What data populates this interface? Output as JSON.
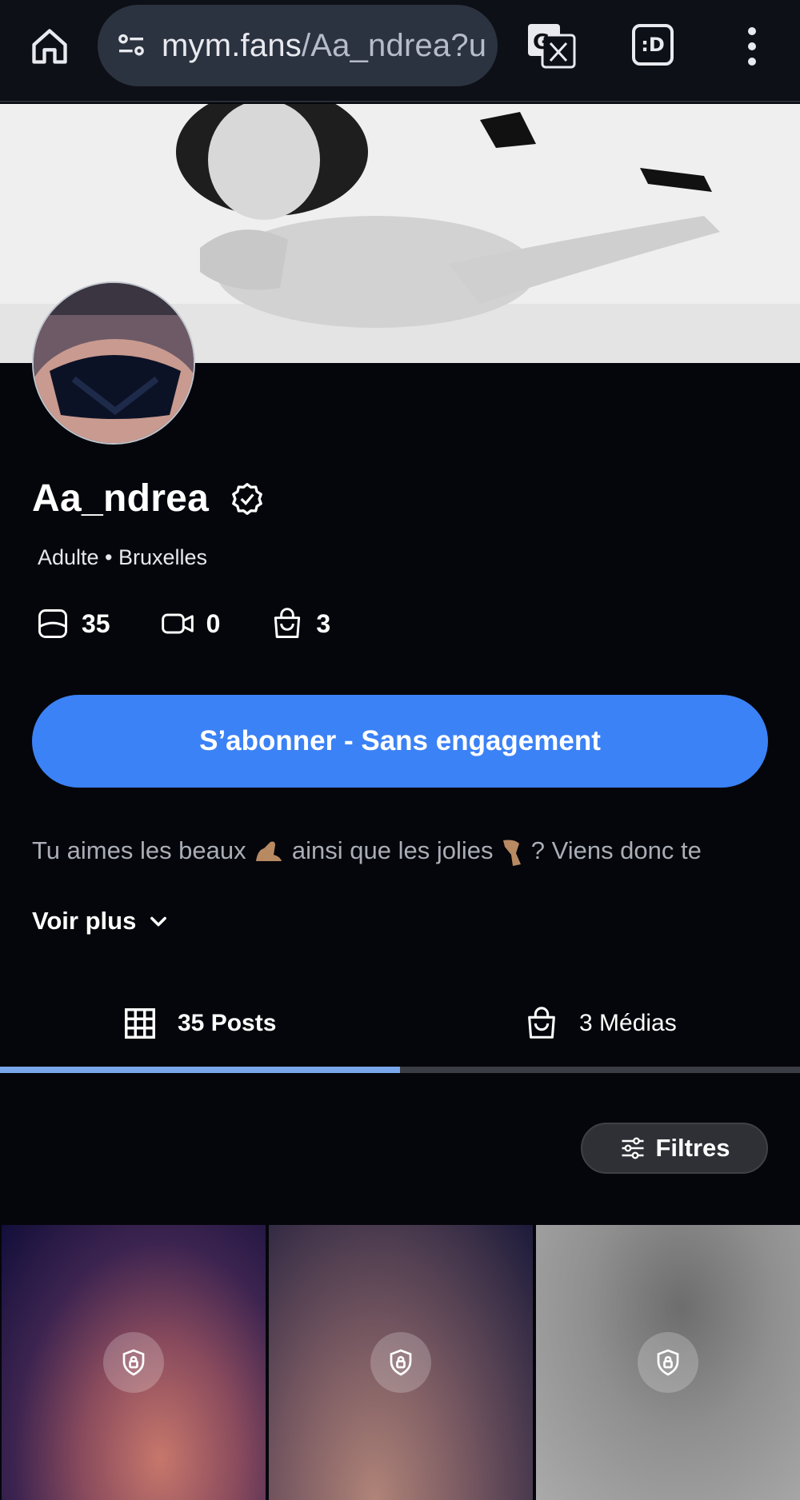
{
  "browser": {
    "url_main": "mym.fans",
    "url_rest": "/Aa_ndrea?u",
    "icons": [
      "home-icon",
      "site-settings-icon",
      "translate-icon",
      "extension-icon",
      "more-vert-icon"
    ]
  },
  "profile": {
    "name": "Aa_ndrea",
    "meta": "Adulte • Bruxelles",
    "stats": {
      "posts": "35",
      "videos": "0",
      "medias": "3"
    }
  },
  "actions": {
    "subscribe_label": "S’abonner - Sans engagement",
    "see_more_label": "Voir plus",
    "filters_label": "Filtres"
  },
  "bio": {
    "part1": "Tu aimes les beaux ",
    "part2": " ainsi que les jolies",
    "part3": " ? Viens donc te"
  },
  "tabs": {
    "posts_label": "35 Posts",
    "medias_label": "3 Médias"
  },
  "colors": {
    "accent": "#3b82f6",
    "tab_indicator": "#7aa7ec",
    "background": "#05060b"
  }
}
